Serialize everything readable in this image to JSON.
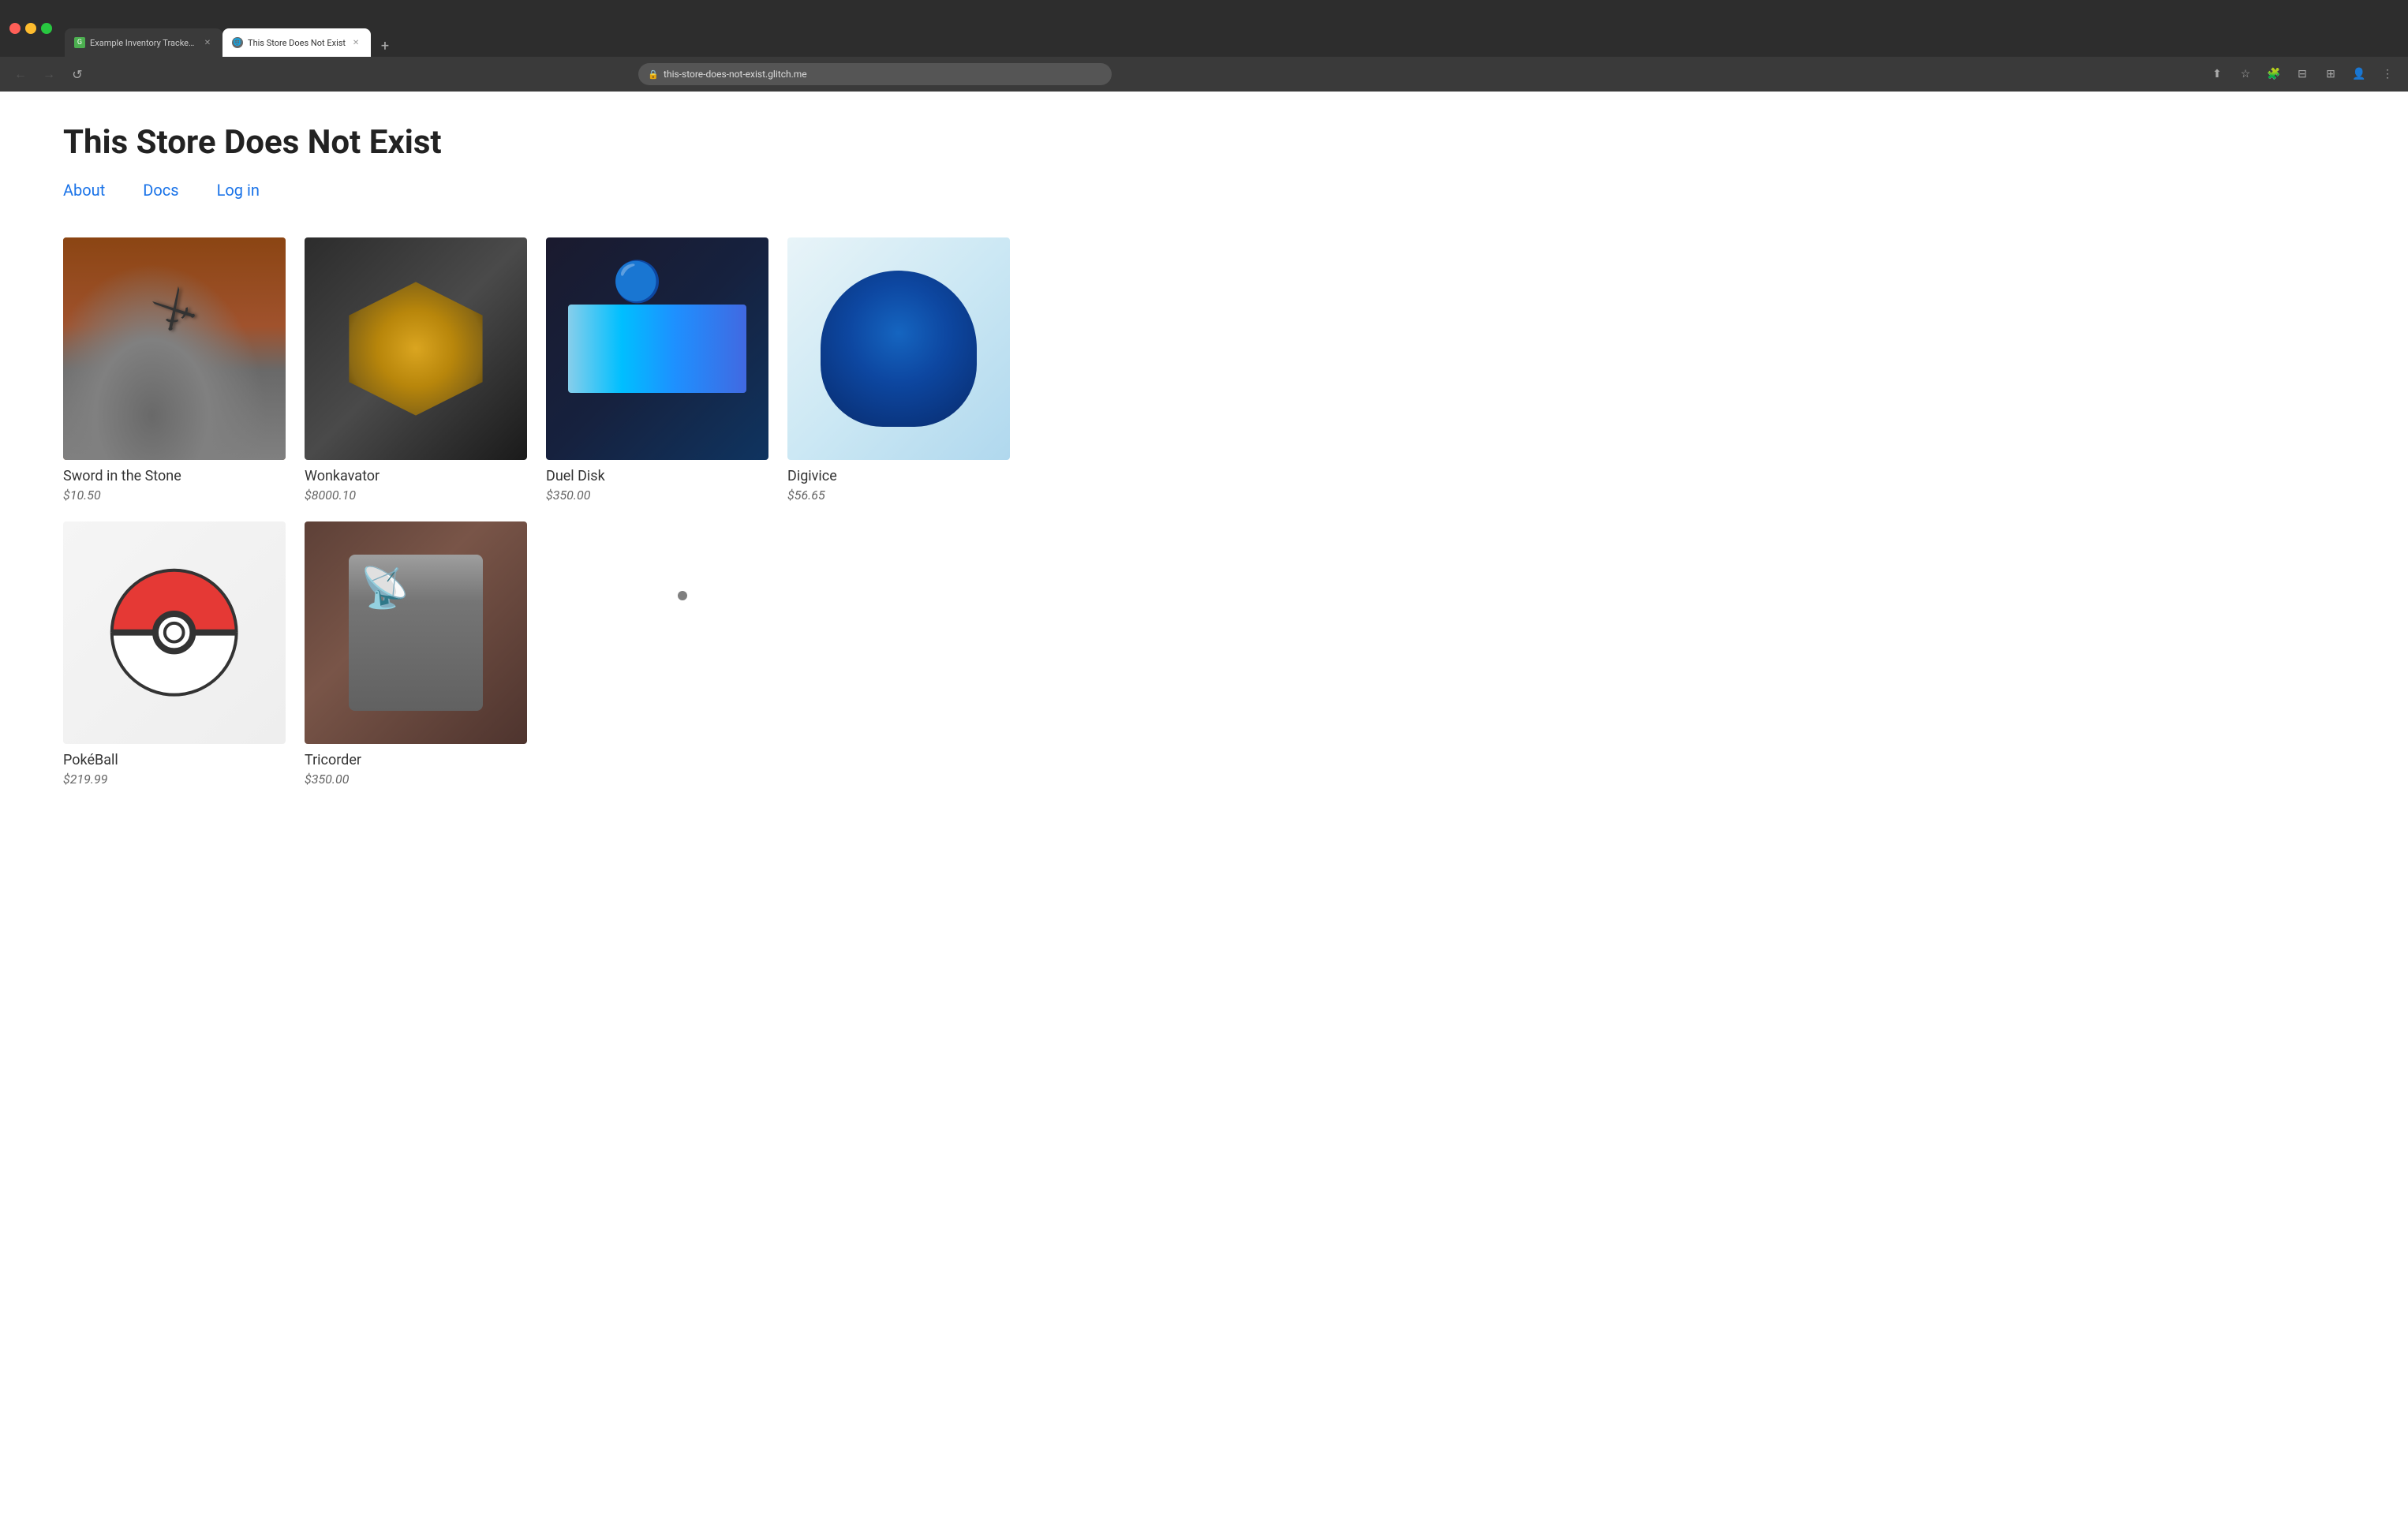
{
  "browser": {
    "tabs": [
      {
        "id": "tab1",
        "title": "Example Inventory Tracker - G...",
        "icon_type": "green",
        "active": false
      },
      {
        "id": "tab2",
        "title": "This Store Does Not Exist",
        "icon_type": "globe",
        "active": true
      }
    ],
    "new_tab_label": "+",
    "url": "this-store-does-not-exist.glitch.me",
    "nav": {
      "back": "←",
      "forward": "→",
      "reload": "↺"
    }
  },
  "page": {
    "title": "This Store Does Not Exist",
    "nav_links": [
      {
        "label": "About",
        "href": "#"
      },
      {
        "label": "Docs",
        "href": "#"
      },
      {
        "label": "Log in",
        "href": "#"
      }
    ],
    "products": [
      {
        "id": "sword-in-the-stone",
        "name": "Sword in the Stone",
        "price": "$10.50",
        "image_type": "sword"
      },
      {
        "id": "wonkavator",
        "name": "Wonkavator",
        "price": "$8000.10",
        "image_type": "wonkavator"
      },
      {
        "id": "duel-disk",
        "name": "Duel Disk",
        "price": "$350.00",
        "image_type": "dueldisk"
      },
      {
        "id": "digivice",
        "name": "Digivice",
        "price": "$56.65",
        "image_type": "digivice"
      },
      {
        "id": "pokeball",
        "name": "PokéBall",
        "price": "$219.99",
        "image_type": "pokeball"
      },
      {
        "id": "tricorder",
        "name": "Tricorder",
        "price": "$350.00",
        "image_type": "tricorder"
      }
    ]
  }
}
